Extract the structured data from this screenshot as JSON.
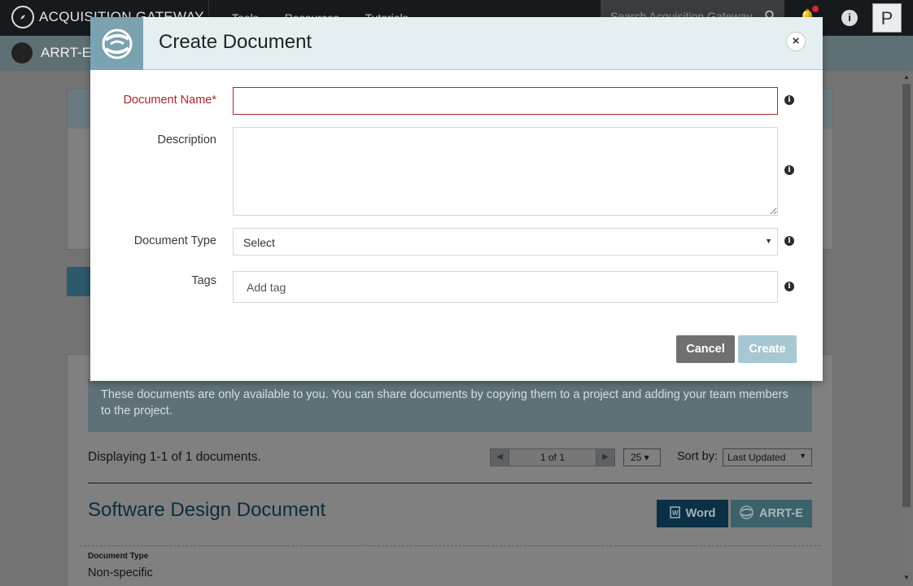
{
  "topbar": {
    "brand": "ACQUISITION GATEWAY",
    "nav": [
      "Tools",
      "Resources",
      "Tutorials"
    ],
    "search_placeholder": "Search Acquisition Gateway",
    "avatar_letter": "P"
  },
  "subbar": {
    "tool_name": "ARRT-E"
  },
  "modal": {
    "title": "Create Document",
    "close_glyph": "×",
    "fields": {
      "name_label": "Document Name*",
      "name_value": "",
      "description_label": "Description",
      "description_value": "",
      "type_label": "Document Type",
      "type_value": "Select",
      "tags_label": "Tags",
      "tags_placeholder": "Add tag"
    },
    "info_glyph": "i",
    "cancel_label": "Cancel",
    "create_label": "Create"
  },
  "background": {
    "share_note": "These documents are only available to you. You can share documents by copying them to a project and adding your team members to the project.",
    "displaying": "Displaying 1-1 of 1 documents.",
    "pager_value": "1 of 1",
    "per_page": "25 ▾",
    "sort_label": "Sort by:",
    "sort_value": "Last Updated",
    "document": {
      "title": "Software Design Document",
      "word_label": "Word",
      "arrte_label": "ARRT-E",
      "type_label": "Document Type",
      "type_value": "Non-specific"
    }
  },
  "colors": {
    "accent": "#7aa2b0",
    "required": "#a8272b",
    "cancel_bg": "#707070",
    "create_bg": "#a6c8d3"
  }
}
